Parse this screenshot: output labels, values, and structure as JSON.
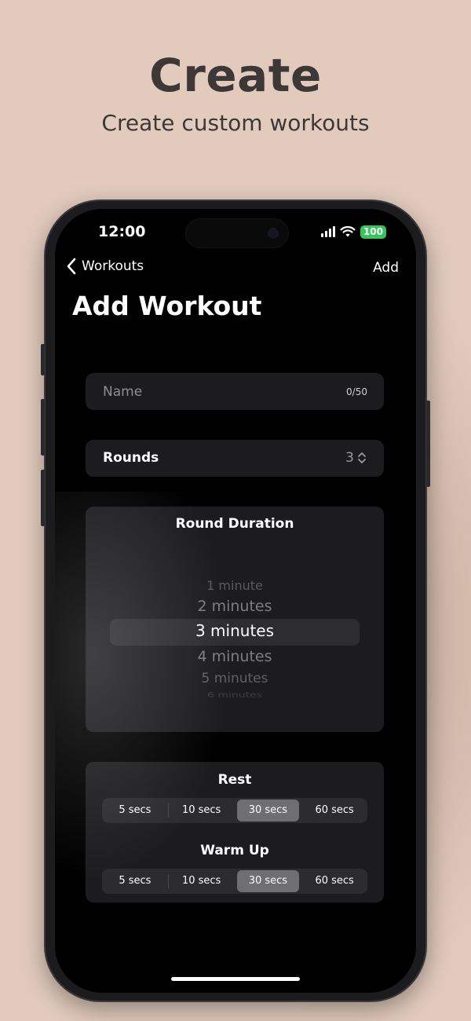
{
  "hero": {
    "title": "Create",
    "subtitle": "Create custom workouts"
  },
  "status_bar": {
    "time": "12:00",
    "battery": "100",
    "icons": [
      "signal-icon",
      "wifi-icon",
      "battery-icon"
    ]
  },
  "nav": {
    "back_label": "Workouts",
    "action_label": "Add"
  },
  "page_title": "Add Workout",
  "name_field": {
    "placeholder": "Name",
    "counter": "0/50"
  },
  "rounds": {
    "label": "Rounds",
    "value": "3"
  },
  "round_duration": {
    "title": "Round Duration",
    "options": [
      "1 minute",
      "2 minutes",
      "3 minutes",
      "4 minutes",
      "5 minutes",
      "6 minutes"
    ],
    "selected": "3 minutes"
  },
  "rest": {
    "title": "Rest",
    "options": [
      "5 secs",
      "10 secs",
      "30 secs",
      "60 secs"
    ],
    "selected": "30 secs"
  },
  "warm_up": {
    "title": "Warm Up",
    "options": [
      "5 secs",
      "10 secs",
      "30 secs",
      "60 secs"
    ],
    "selected": "30 secs"
  },
  "colors": {
    "background": "#e2cbbd",
    "accent_battery": "#34c759",
    "card": "#1c1c1e",
    "segment_selected": "#6e6e73"
  }
}
